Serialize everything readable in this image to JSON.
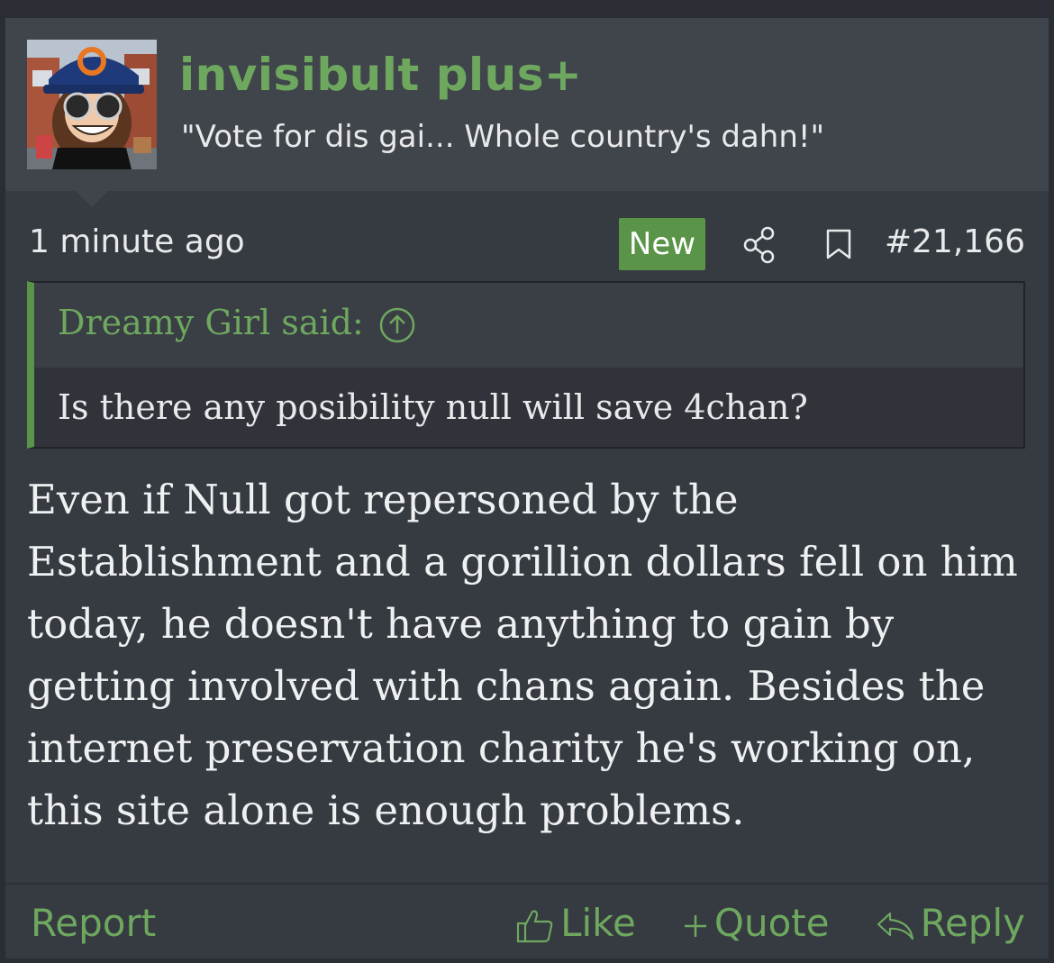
{
  "user": {
    "name": "invisibult plus+",
    "title": "\"Vote for dis gai... Whole country's dahn!\""
  },
  "meta": {
    "time": "1 minute ago",
    "badge": "New",
    "post_number": "#21,166"
  },
  "quote": {
    "author": "Dreamy Girl said:",
    "text": "Is there any posibility null will save 4chan?"
  },
  "message": "Even if Null got repersoned by the Establishment and a gorillion dollars fell on him today, he doesn't have anything to gain by getting involved with chans again. Besides the internet preservation charity he's working on, this site alone is enough problems.",
  "footer": {
    "report": "Report",
    "like": "Like",
    "quote": "Quote",
    "reply": "Reply"
  },
  "colors": {
    "accent": "#6ea85f",
    "badge": "#5a9448",
    "background": "#363a41"
  }
}
